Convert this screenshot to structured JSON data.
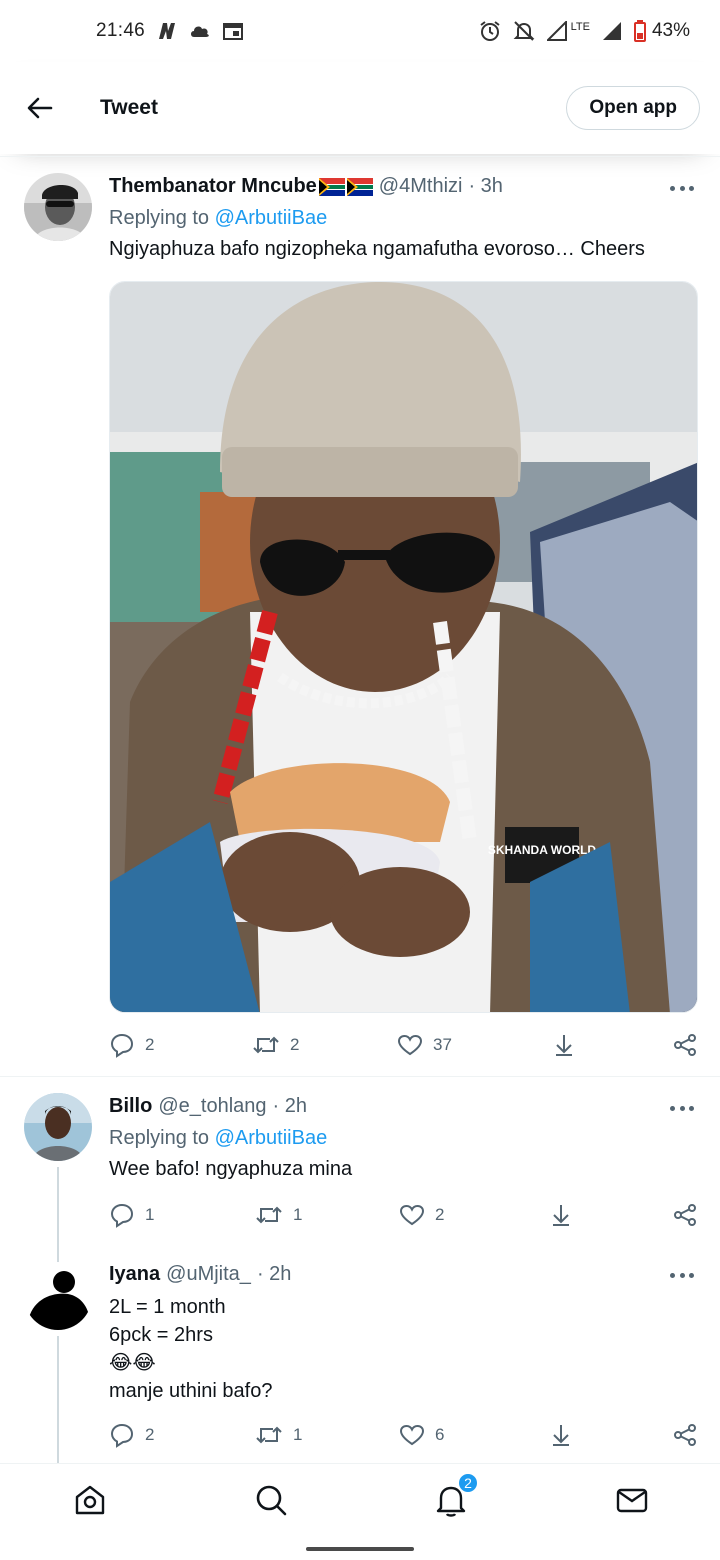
{
  "status_bar": {
    "time": "21:46",
    "network": "LTE",
    "battery": "43%"
  },
  "header": {
    "title": "Tweet",
    "open_app_label": "Open app"
  },
  "tweets": [
    {
      "name": "Thembanator Mncube",
      "handle": "@4Mthizi",
      "time": "· 3h",
      "replying_prefix": "Replying to ",
      "replying_to": "@ArbutiiBae",
      "text": "Ngiyaphuza bafo ngizopheka ngamafutha evoroso… Cheers",
      "replies": "2",
      "retweets": "2",
      "likes": "37",
      "media_badge_text": "SKHANDA WORLD"
    },
    {
      "name": "Billo",
      "handle": "@e_tohlang",
      "time": "· 2h",
      "replying_prefix": "Replying to ",
      "replying_to": "@ArbutiiBae",
      "text": "Wee bafo! ngyaphuza mina",
      "replies": "1",
      "retweets": "1",
      "likes": "2"
    },
    {
      "name": "Iyana",
      "handle": "@uMjita_",
      "time": "· 2h",
      "lines": [
        "2L = 1 month",
        "6pck = 2hrs",
        "😂😂",
        "manje uthini bafo?"
      ],
      "replies": "2",
      "retweets": "1",
      "likes": "6"
    }
  ],
  "bottom_nav": {
    "notifications_badge": "2"
  },
  "colors": {
    "accent": "#1d9bf0",
    "text": "#0f1419",
    "secondary": "#536471"
  }
}
